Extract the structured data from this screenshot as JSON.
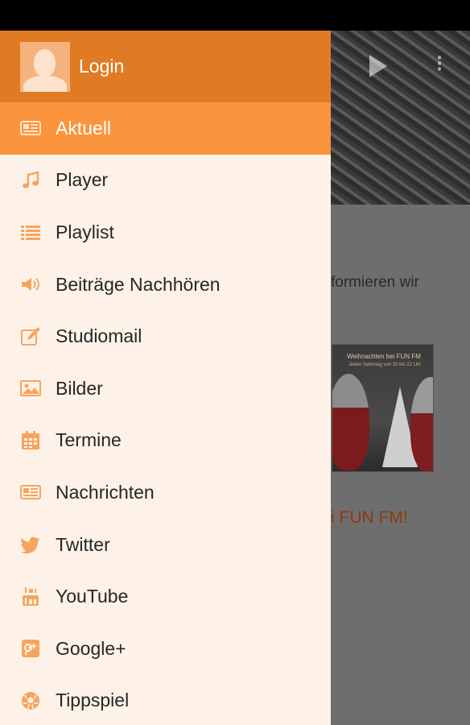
{
  "drawer": {
    "login_label": "Login",
    "items": [
      {
        "label": "Aktuell",
        "icon": "newspaper-icon",
        "active": true
      },
      {
        "label": "Player",
        "icon": "music-note-icon"
      },
      {
        "label": "Playlist",
        "icon": "list-icon"
      },
      {
        "label": "Beiträge Nachhören",
        "icon": "speaker-icon"
      },
      {
        "label": "Studiomail",
        "icon": "edit-icon"
      },
      {
        "label": "Bilder",
        "icon": "image-icon"
      },
      {
        "label": "Termine",
        "icon": "calendar-icon"
      },
      {
        "label": "Nachrichten",
        "icon": "news-icon"
      },
      {
        "label": "Twitter",
        "icon": "twitter-icon"
      },
      {
        "label": "YouTube",
        "icon": "youtube-icon"
      },
      {
        "label": "Google+",
        "icon": "google-plus-icon"
      },
      {
        "label": "Tippspiel",
        "icon": "soccer-ball-icon"
      }
    ]
  },
  "background": {
    "text_fragment": "formieren wir",
    "image_caption": "Weihnachten bei FUN FM",
    "image_subcaption": "Jeden Samstag von 20 bis 22 Uhr",
    "headline_fragment": "i FUN FM!"
  },
  "colors": {
    "header": "#e07b23",
    "active_item": "#fa943d",
    "drawer_bg": "#fef2e8",
    "icon": "#f5a560"
  }
}
